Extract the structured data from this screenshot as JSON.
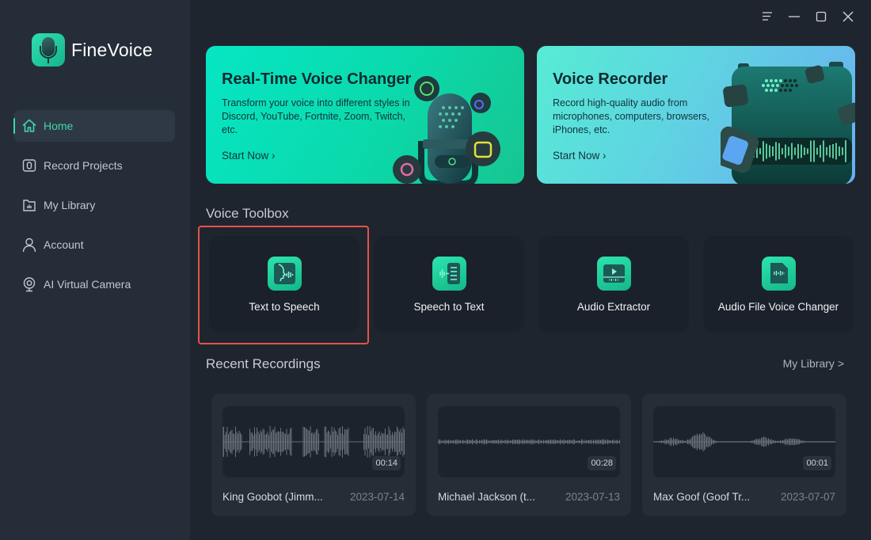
{
  "app": {
    "name": "FineVoice"
  },
  "window_controls": {
    "menu": "menu-icon",
    "minimize": "minimize-icon",
    "maximize": "maximize-icon",
    "close": "close-icon"
  },
  "sidebar": {
    "items": [
      {
        "label": "Home",
        "icon": "home-icon",
        "active": true
      },
      {
        "label": "Record Projects",
        "icon": "record-projects-icon",
        "active": false
      },
      {
        "label": "My Library",
        "icon": "library-folder-icon",
        "active": false
      },
      {
        "label": "Account",
        "icon": "user-icon",
        "active": false
      },
      {
        "label": "AI Virtual Camera",
        "icon": "webcam-icon",
        "active": false
      }
    ]
  },
  "banners": [
    {
      "title": "Real-Time Voice Changer",
      "description": "Transform your voice into different styles in Discord, YouTube, Fortnite, Zoom, Twitch, etc.",
      "cta": "Start Now",
      "cta_icon": "chevron-right-icon"
    },
    {
      "title": "Voice Recorder",
      "description": "Record high-quality audio from microphones, computers, browsers, iPhones, etc.",
      "cta": "Start Now",
      "cta_icon": "chevron-right-icon"
    }
  ],
  "toolbox": {
    "title": "Voice Toolbox",
    "highlighted": "Text to Speech",
    "tools": [
      {
        "label": "Text to Speech",
        "icon": "text-to-speech-icon"
      },
      {
        "label": "Speech to Text",
        "icon": "speech-to-text-icon"
      },
      {
        "label": "Audio Extractor",
        "icon": "audio-extractor-icon"
      },
      {
        "label": "Audio File Voice Changer",
        "icon": "audio-file-icon"
      }
    ]
  },
  "recent": {
    "title": "Recent Recordings",
    "link": "My Library >",
    "items": [
      {
        "name": "King Goobot (Jimm...",
        "date": "2023-07-14",
        "duration": "00:14"
      },
      {
        "name": "Michael Jackson (t...",
        "date": "2023-07-13",
        "duration": "00:28"
      },
      {
        "name": "Max Goof (Goof Tr...",
        "date": "2023-07-07",
        "duration": "00:01"
      }
    ]
  },
  "colors": {
    "accent": "#3fd8a6",
    "highlight": "#e5524c",
    "sidebar": "#252d38",
    "background": "#1f252e"
  }
}
